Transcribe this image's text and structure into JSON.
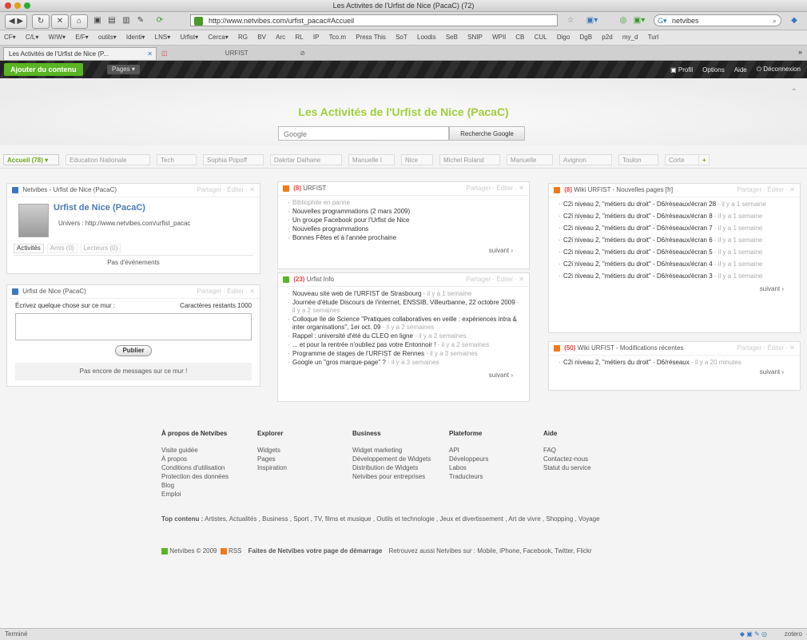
{
  "window": {
    "title": "Les Activites de l'Urfist de Nice (PacaC) (72)"
  },
  "browser": {
    "url": "http://www.netvibes.com/urfist_pacac#Accueil",
    "search_value": "netvibes",
    "bookmarks": [
      "CF▾",
      "C/L▾",
      "W/W▾",
      "E/F▾",
      "outils▾",
      "Identi▾",
      "LNS▾",
      "Urfist▾",
      "Cerca▾",
      "RG",
      "BV",
      "Arc",
      "RL",
      "IP",
      "Tco.m",
      "Press This",
      "SoT",
      "Loodis",
      "SeB",
      "SNIP",
      "WPIl",
      "CB",
      "CUL",
      "Digo",
      "DgB",
      "p2d",
      "my_d",
      "Turl"
    ],
    "tabs": [
      {
        "label": "Les Activités de l'Urfist de Nice (P..."
      },
      {
        "label": "URFIST"
      }
    ]
  },
  "netvibes_bar": {
    "add_content": "Ajouter du contenu",
    "pages": "Pages ▾",
    "right_links": [
      "Profil",
      "Options",
      "Aide",
      "Déconnexion"
    ]
  },
  "header": {
    "site_title": "Les Activités de l'Urfist de Nice (PacaC)",
    "search_placeholder": "Google",
    "search_button": "Recherche Google"
  },
  "page_tabs": [
    "Accueil (78) ▾",
    "Education Nationale",
    "Tech",
    "Sophia Popoff",
    "Dakrtar Dalhane",
    "Manuelle I",
    "Nice",
    "Michel Roland",
    "Manuelle",
    "Avignon",
    "Toulon",
    "Corte",
    "+"
  ],
  "widgets": {
    "profile": {
      "header": "Netvibes - Urfist de Nice (PacaC)",
      "actions": "Partager · Éditer · ✕",
      "name": "Urfist de Nice (PacaC)",
      "univers": "Univers : http://www.netvibes.com/urfist_pacac",
      "tabs": [
        "Activités",
        "Amis (0)",
        "Lecteurs (0)"
      ],
      "empty": "Pas d'événements"
    },
    "wall": {
      "header": "Urfist de Nice (PacaC)",
      "actions": "Partager · Éditer · ✕",
      "prompt": "Écrivez quelque chose sur ce mur :",
      "chars": "Caractères restants 1000",
      "publish": "Publier",
      "empty": "Pas encore de messages sur ce mur !"
    },
    "urfist": {
      "header": "URFIST",
      "badge": "(8)",
      "actions": "Partager · Éditer · ✕",
      "items": [
        "Bibliophile en panne",
        "Nouvelles programmations (2 mars 2009)",
        "Un groupe Facebook pour l'Urfist de Nice",
        "Nouvelles programmations",
        "Bonnes Fêtes et à l'année prochaine"
      ],
      "next": "suivant ›"
    },
    "urfist_info": {
      "header": "Urfist Info",
      "badge": "(23)",
      "actions": "Partager · Éditer · ✕",
      "items": [
        {
          "text": "Nouveau site web de l'URFIST de Strasbourg",
          "meta": "- il y a 1 semaine"
        },
        {
          "text": "Journée d'étude Discours de l'internet, ENSSIB, Villeurbanne, 22 octobre 2009",
          "meta": "- il y a 2 semaines"
        },
        {
          "text": "Colloque Ile de Science \"Pratiques collaboratives en veille : expériences intra & inter organisations\", 1er oct. 09",
          "meta": "- il y a 2 semaines"
        },
        {
          "text": "Rappel : université d'été du CLEO en ligne",
          "meta": "- il y a 2 semaines"
        },
        {
          "text": "... et pour la rentrée n'oubliez pas votre Entonnoir !",
          "meta": "- il y a 2 semaines"
        },
        {
          "text": "Programme de stages de l'URFIST de Rennes",
          "meta": "- il y a 3 semaines"
        },
        {
          "text": "Google un \"gros marque-page\" ?",
          "meta": "- il y a 3 semaines"
        }
      ],
      "next": "suivant ›"
    },
    "wiki_new": {
      "header": "Wiki URFIST - Nouvelles pages [fr]",
      "badge": "(8)",
      "actions": "Partager · Éditer · ✕",
      "items": [
        {
          "text": "C2i niveau 2, \"métiers du droit\" - D6/réseaux/écran 28",
          "meta": "- il y a 1 semaine"
        },
        {
          "text": "C2i niveau 2, \"métiers du droit\" - D6/réseaux/écran 8",
          "meta": "- il y a 1 semaine"
        },
        {
          "text": "C2i niveau 2, \"métiers du droit\" - D6/réseaux/écran 7",
          "meta": "- il y a 1 semaine"
        },
        {
          "text": "C2i niveau 2, \"métiers du droit\" - D6/réseaux/écran 6",
          "meta": "- il y a 1 semaine"
        },
        {
          "text": "C2i niveau 2, \"métiers du droit\" - D6/réseaux/écran 5",
          "meta": "- il y a 1 semaine"
        },
        {
          "text": "C2i niveau 2, \"métiers du droit\" - D6/réseaux/écran 4",
          "meta": "- il y a 1 semaine"
        },
        {
          "text": "C2i niveau 2, \"métiers du droit\" - D6/réseaux/écran 3",
          "meta": "- il y a 1 semaine"
        }
      ],
      "next": "suivant ›"
    },
    "wiki_mod": {
      "header": "Wiki URFIST - Modifications récentes",
      "badge": "(50)",
      "actions": "Partager · Éditer · ✕",
      "items": [
        {
          "text": "C2i niveau 2, \"métiers du droit\" - D6/réseaux",
          "meta": "- il y a 20 minutes"
        }
      ],
      "next": "suivant ›"
    }
  },
  "footer": {
    "columns": [
      {
        "title": "À propos de Netvibes",
        "items": [
          "Visite guidée",
          "À propos",
          "Conditions d'utilisation",
          "Protection des données",
          "Blog",
          "Emploi"
        ]
      },
      {
        "title": "Explorer",
        "items": [
          "Widgets",
          "Pages",
          "Inspiration"
        ]
      },
      {
        "title": "Business",
        "items": [
          "Widget marketing",
          "Développement de Widgets",
          "Distribution de Widgets",
          "Netvibes pour entreprises"
        ]
      },
      {
        "title": "Plateforme",
        "items": [
          "API",
          "Développeurs",
          "Labos",
          "Traducteurs"
        ]
      },
      {
        "title": "Aide",
        "items": [
          "FAQ",
          "Contactez-nous",
          "Statut du service"
        ]
      }
    ],
    "top_label": "Top contenu :",
    "top_content": "Artistes, Actualités , Business , Sport , TV, films et musique , Outils et technologie , Jeux et divertissement , Art de vivre , Shopping , Voyage",
    "copyright": "Netvibes © 2009",
    "rss": "RSS",
    "tagline": "Faites de Netvibes votre page de démarrage",
    "also": "Retrouvez aussi Netvibes sur : Mobile, iPhone, Facebook, Twitter, Flickr"
  },
  "statusbar": {
    "left": "Terminé",
    "right": "zotero"
  },
  "colors": {
    "accent_green": "#59b522",
    "title_green": "#9fcf3a",
    "rss_orange": "#f07a1a",
    "dark_bar": "#262626"
  }
}
